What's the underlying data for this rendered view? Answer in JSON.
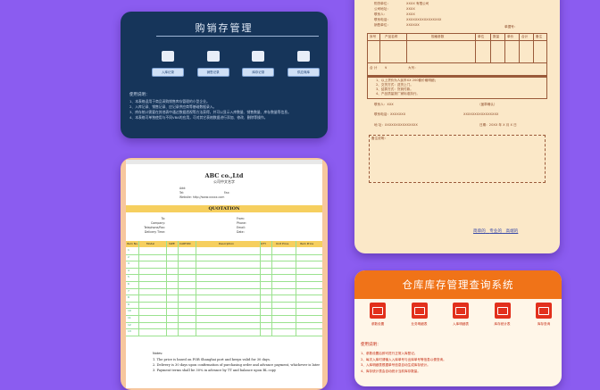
{
  "card1": {
    "title": "购销存管理",
    "modules": [
      {
        "icon": "folder-open-icon",
        "label": "入库记录"
      },
      {
        "icon": "folder-share-icon",
        "label": "销售记录"
      },
      {
        "icon": "book-icon",
        "label": "库存记录"
      },
      {
        "icon": "notebook-icon",
        "label": "供应商库"
      }
    ],
    "notes_heading": "使用说明：",
    "notes": [
      "1、本表格适用于商品采购销售库存管理的小型企业。",
      "2、入库记录、销售记录、应记录供应商等基础数据录入。",
      "3、库存统计需要在其他表中通过数据透视等方法获得，并可以显示入库数量、销售数量、库存数量等信息。",
      "4、本表格可单独使用与不同VBA的应用，可对其它表格数据进行添加、修改、删除等操作。"
    ]
  },
  "card2": {
    "company": "ABC co.,Ltd",
    "company_cn": "公司中文名字",
    "addr_lines": [
      "Add:",
      "Tel:",
      "Website: http://www.xxxxx.com"
    ],
    "fax": "Fax:",
    "title": "QUOTATION",
    "left_fields": [
      "To:",
      "Company:",
      "Telephone/Fax:",
      "Delivery Time:"
    ],
    "right_fields": [
      "From:",
      "Phone:",
      "Email:",
      "Date:"
    ],
    "columns": [
      "Item No.",
      "Model",
      "SIZE",
      "CARTON",
      "Description",
      "QTY",
      "Unit Price",
      "Item Price"
    ],
    "row_numbers": [
      "1",
      "2",
      "3",
      "4",
      "5",
      "6",
      "7",
      "8",
      "9",
      "10",
      "11",
      "12",
      "13"
    ],
    "notes_heading": "Notes:",
    "notes": [
      "1. The price is based on FOB Shanghai port and keeps valid for 30 days.",
      "2. Delivery is 30 days upon confirmation of purchasing order and advance payment, whichever is later",
      "3. Payment terms shall be 30% in advance by TT and balance upon BL copy"
    ]
  },
  "card3": {
    "top_fields": [
      "购货单位：",
      "公司地址：",
      "联系人：",
      "联系电话：",
      "销售单位："
    ],
    "top_values": [
      "XXXX 有限公司",
      "XXXX",
      "XXXX",
      "XXXXXXXXXXXXXXXX",
      "XXXXXX"
    ],
    "right_field": "单据号：",
    "row_labels": [
      "序号",
      "产品名称",
      "规格参数",
      "单位",
      "数量",
      "单价",
      "合计",
      "备注"
    ],
    "total_label": "合 计",
    "total_yen": "¥",
    "total_upper": "大写：",
    "terms": [
      "1、以上货价为人民币XX 200套价格明细；",
      "2、交货方式：送货上门。",
      "3、结算方式：货到付款。",
      "4、产品质量按厂家标准执行。"
    ],
    "seller": "联系人：XXX",
    "buyer": "（盖章确认）",
    "seller_tel": "联系电话：XXXXXXX",
    "buyer_tel": "XXXXXXXXXXXXXXXX",
    "addr": "地  址：XXXXXXXXXXXXXXX",
    "date": "日期：20XX 年 X 月 X 日",
    "remark": "备注说明：",
    "links": [
      "简单的",
      "专业的",
      "高端的"
    ]
  },
  "card4": {
    "title": "仓库库存管理查询系统",
    "modules": [
      {
        "icon": "gear-icon",
        "label": "参数设置"
      },
      {
        "icon": "truck-icon",
        "label": "业务明细表"
      },
      {
        "icon": "warehouse-icon",
        "label": "入库明细表"
      },
      {
        "icon": "chart-icon",
        "label": "库存统计表"
      },
      {
        "icon": "search-icon",
        "label": "库存查询"
      }
    ],
    "notes_heading": "使用说明：",
    "notes": [
      "1、参数设置后即可进行正常入库登记。",
      "2、每次入库时请输入入库单号与出库单号等信息以便查询。",
      "3、入库明细表根据单号信息自动生成库存统计。",
      "4、库存统计表会自动统计当前库存数量。"
    ]
  }
}
